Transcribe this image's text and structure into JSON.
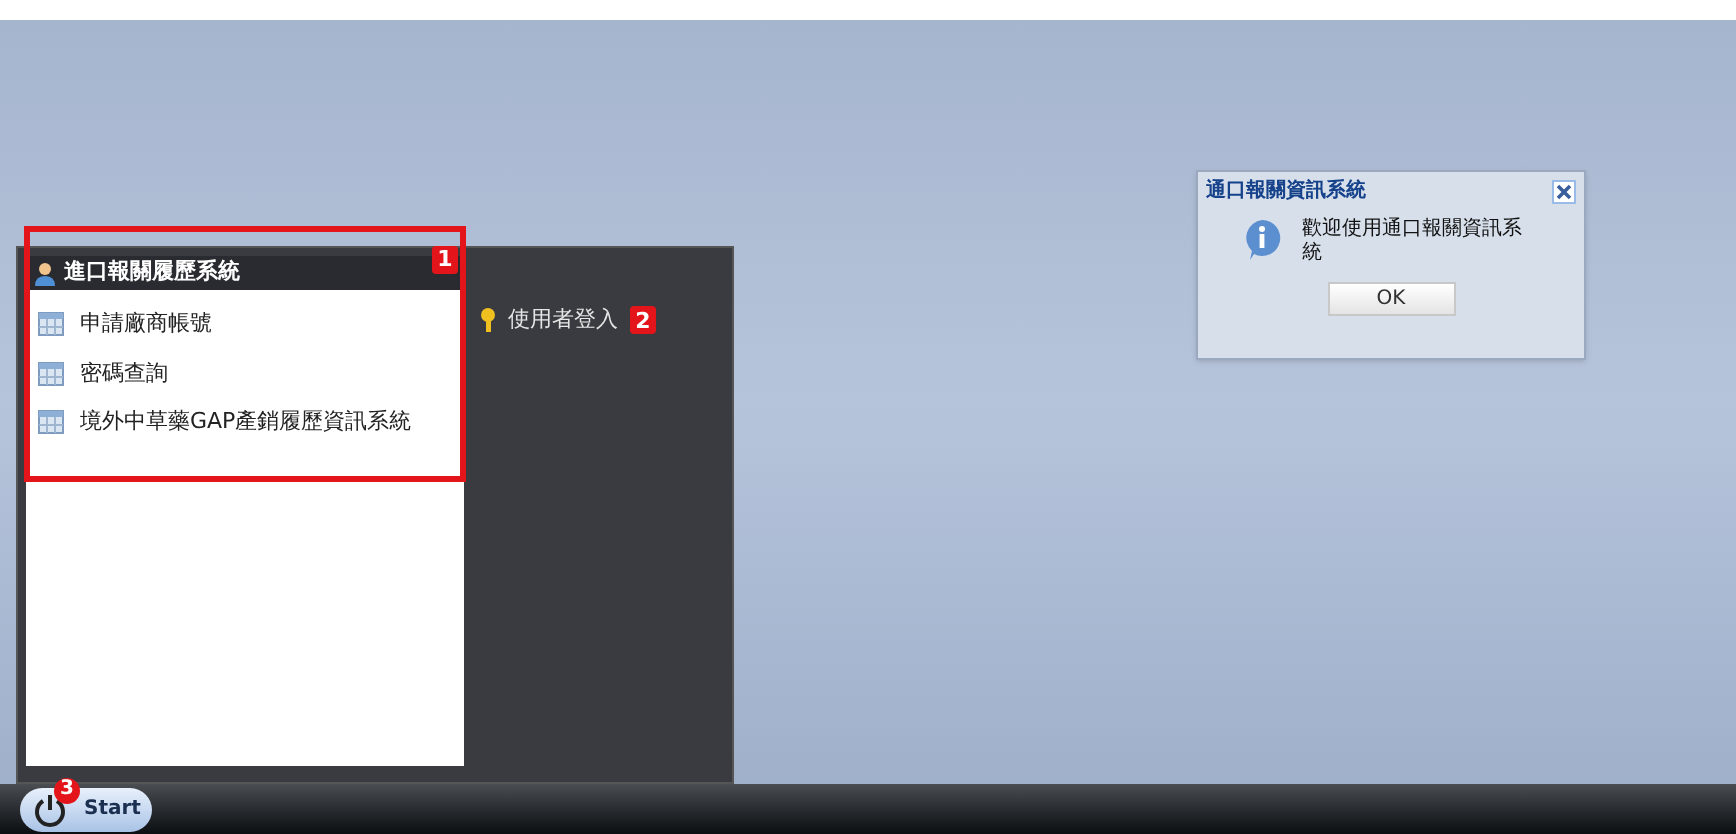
{
  "start_menu": {
    "title": "進口報關履歷系統",
    "items": [
      {
        "label": "申請廠商帳號"
      },
      {
        "label": "密碼查詢"
      },
      {
        "label": "境外中草藥GAP產銷履歷資訊系統"
      }
    ],
    "side_items": [
      {
        "label": "使用者登入"
      }
    ]
  },
  "dialog": {
    "title": "通口報關資訊系統",
    "message": "歡迎使用通口報關資訊系統",
    "button": "OK"
  },
  "taskbar": {
    "start_label": "Start"
  },
  "annotations": [
    "1",
    "2",
    "3"
  ]
}
